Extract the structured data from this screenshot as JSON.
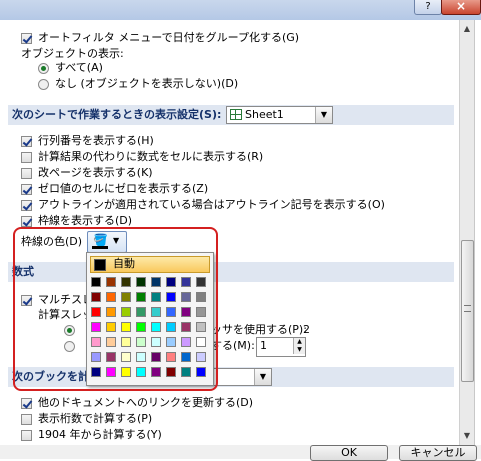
{
  "title_bar": {
    "help_icon": "?",
    "close_icon": "×"
  },
  "top_options": {
    "group_dates": "オートフィルタ メニューで日付をグループ化する(G)",
    "objects_label": "オブジェクトの表示:",
    "radio_all": "すべて(A)",
    "radio_none": "なし (オブジェクトを表示しない)(D)"
  },
  "sheet_section": {
    "header": "次のシートで作業するときの表示設定(S):",
    "selected_sheet": "Sheet1",
    "options": [
      {
        "label": "行列番号を表示する(H)",
        "checked": true
      },
      {
        "label": "計算結果の代わりに数式をセルに表示する(R)",
        "checked": false
      },
      {
        "label": "改ページを表示する(K)",
        "checked": false
      },
      {
        "label": "ゼロ値のセルにゼロを表示する(Z)",
        "checked": true
      },
      {
        "label": "アウトラインが適用されている場合はアウトライン記号を表示する(O)",
        "checked": true
      },
      {
        "label": "枠線を表示する(D)",
        "checked": true
      }
    ],
    "gridline_color_label": "枠線の色(D)"
  },
  "formula_section": {
    "header": "数式",
    "multithread_label": "マルチスレッ",
    "calc_threads_label": "計算スレッド",
    "use_threads_label": "ッサを使用する(P):",
    "use_threads_value": "2",
    "manual_label": "する(M):",
    "manual_value": "1"
  },
  "book_section": {
    "header": "次のブックを計算",
    "options": [
      {
        "label": "他のドキュメントへのリンクを更新する(D)",
        "checked": true
      },
      {
        "label": "表示桁数で計算する(P)",
        "checked": false
      },
      {
        "label": "1904 年から計算する(Y)",
        "checked": false
      }
    ]
  },
  "footer": {
    "ok": "OK",
    "cancel": "キャンセル"
  },
  "palette": {
    "auto_label": "自動",
    "rows": [
      [
        "#000000",
        "#993300",
        "#333300",
        "#003300",
        "#003366",
        "#000080",
        "#333399",
        "#333333"
      ],
      [
        "#800000",
        "#FF6600",
        "#808000",
        "#008000",
        "#008080",
        "#0000FF",
        "#666699",
        "#808080"
      ],
      [
        "#FF0000",
        "#FF9900",
        "#99CC00",
        "#339966",
        "#33CCCC",
        "#3366FF",
        "#800080",
        "#969696"
      ],
      [
        "#FF00FF",
        "#FFCC00",
        "#FFFF00",
        "#00FF00",
        "#00FFFF",
        "#00CCFF",
        "#993366",
        "#C0C0C0"
      ],
      [
        "#FF99CC",
        "#FFCC99",
        "#FFFF99",
        "#CCFFCC",
        "#CCFFFF",
        "#99CCFF",
        "#CC99FF",
        "#FFFFFF"
      ],
      [
        "#9999FF",
        "#993366",
        "#FFFFCC",
        "#CCFFFF",
        "#660066",
        "#FF8080",
        "#0066CC",
        "#CCCCFF"
      ],
      [
        "#000080",
        "#FF00FF",
        "#FFFF00",
        "#00FFFF",
        "#800080",
        "#800000",
        "#008080",
        "#0000FF"
      ]
    ]
  }
}
